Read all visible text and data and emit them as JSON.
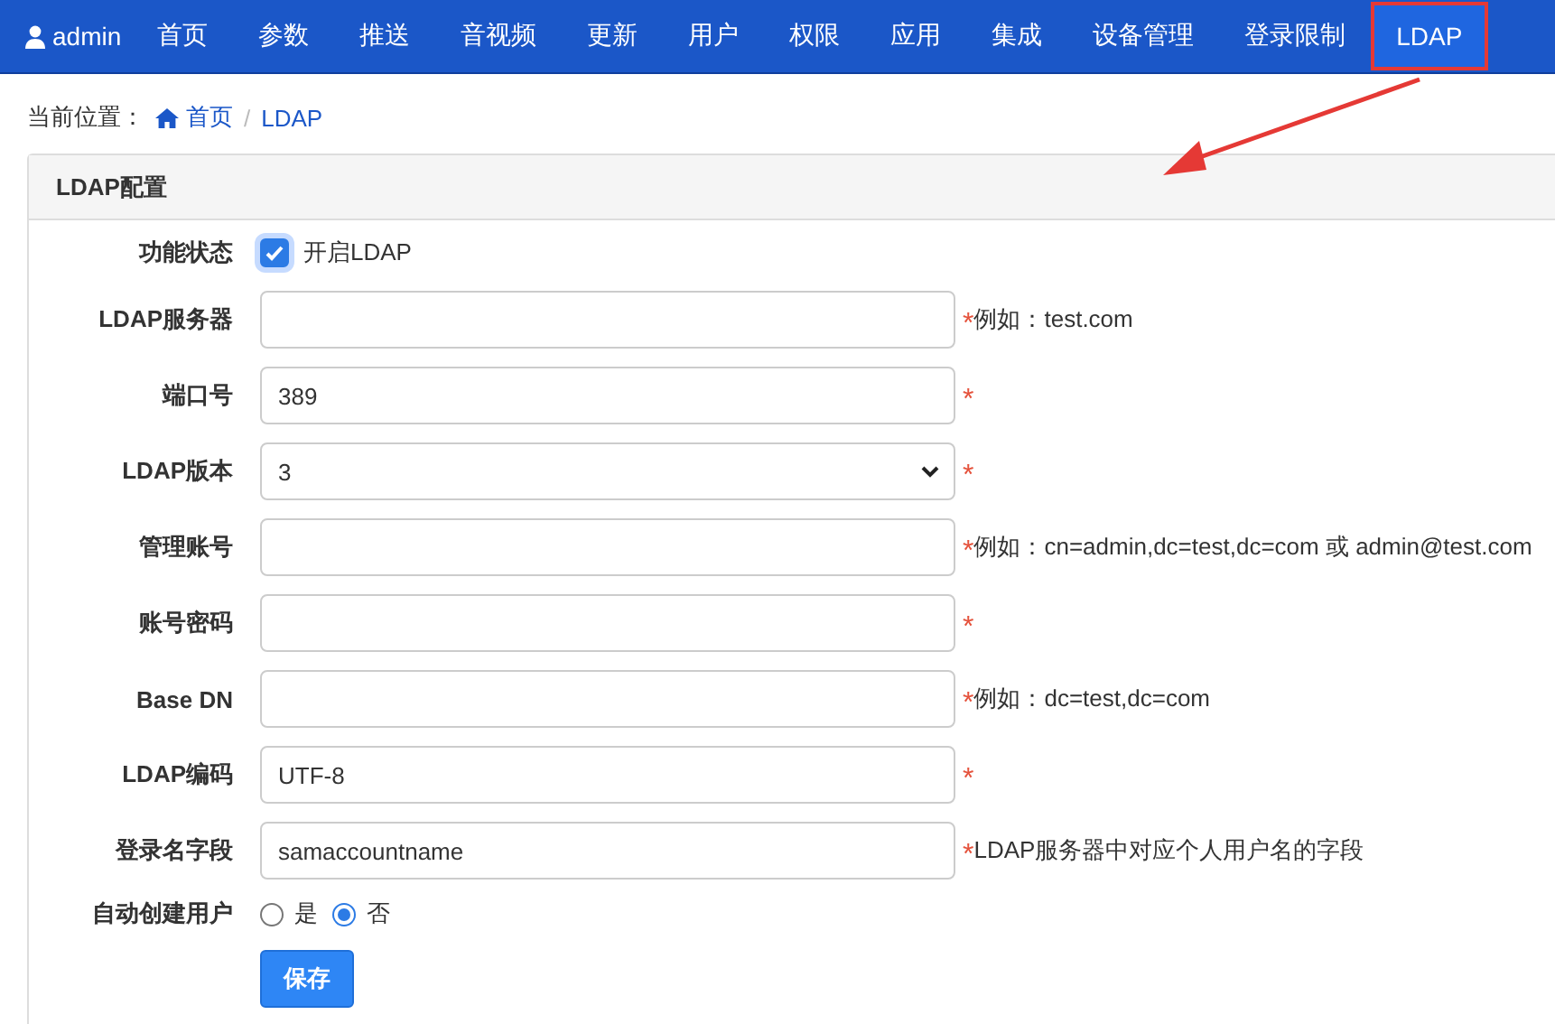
{
  "nav": {
    "user": "admin",
    "items": [
      {
        "label": "首页",
        "selected": false,
        "highlighted": false
      },
      {
        "label": "参数",
        "selected": false,
        "highlighted": false
      },
      {
        "label": "推送",
        "selected": false,
        "highlighted": false
      },
      {
        "label": "音视频",
        "selected": false,
        "highlighted": false
      },
      {
        "label": "更新",
        "selected": false,
        "highlighted": false
      },
      {
        "label": "用户",
        "selected": false,
        "highlighted": false
      },
      {
        "label": "权限",
        "selected": false,
        "highlighted": false
      },
      {
        "label": "应用",
        "selected": false,
        "highlighted": false
      },
      {
        "label": "集成",
        "selected": false,
        "highlighted": false
      },
      {
        "label": "设备管理",
        "selected": false,
        "highlighted": false
      },
      {
        "label": "登录限制",
        "selected": false,
        "highlighted": false
      },
      {
        "label": "LDAP",
        "selected": true,
        "highlighted": true
      }
    ]
  },
  "breadcrumb": {
    "prefix": "当前位置：",
    "items": [
      "首页",
      "LDAP"
    ],
    "separator": "/"
  },
  "panel": {
    "title": "LDAP配置",
    "fields": [
      {
        "kind": "checkbox",
        "label": "功能状态",
        "checked": true,
        "option": "开启LDAP"
      },
      {
        "kind": "text",
        "label": "LDAP服务器",
        "mark": "*",
        "hint": "例如：test.com"
      },
      {
        "kind": "text",
        "label": "端口号",
        "value": "389",
        "mark": "*"
      },
      {
        "kind": "select",
        "label": "LDAP版本",
        "value": "3",
        "mark": "*"
      },
      {
        "kind": "text",
        "label": "管理账号",
        "mark": "*",
        "hint": "例如：cn=admin,dc=test,dc=com 或 admin@test.com"
      },
      {
        "kind": "text",
        "label": "账号密码",
        "mark": "*"
      },
      {
        "kind": "text",
        "label": "Base DN",
        "mark": "*",
        "hint": "例如：dc=test,dc=com"
      },
      {
        "kind": "text",
        "label": "LDAP编码",
        "value": "UTF-8",
        "mark": "*"
      },
      {
        "kind": "text",
        "label": "登录名字段",
        "value": "samaccountname",
        "mark": "*",
        "hint": "LDAP服务器中对应个人用户名的字段"
      },
      {
        "kind": "radio",
        "label": "自动创建用户",
        "options": [
          {
            "label": "是",
            "selected": false
          },
          {
            "label": "否",
            "selected": true
          }
        ]
      }
    ],
    "save": "保存"
  }
}
